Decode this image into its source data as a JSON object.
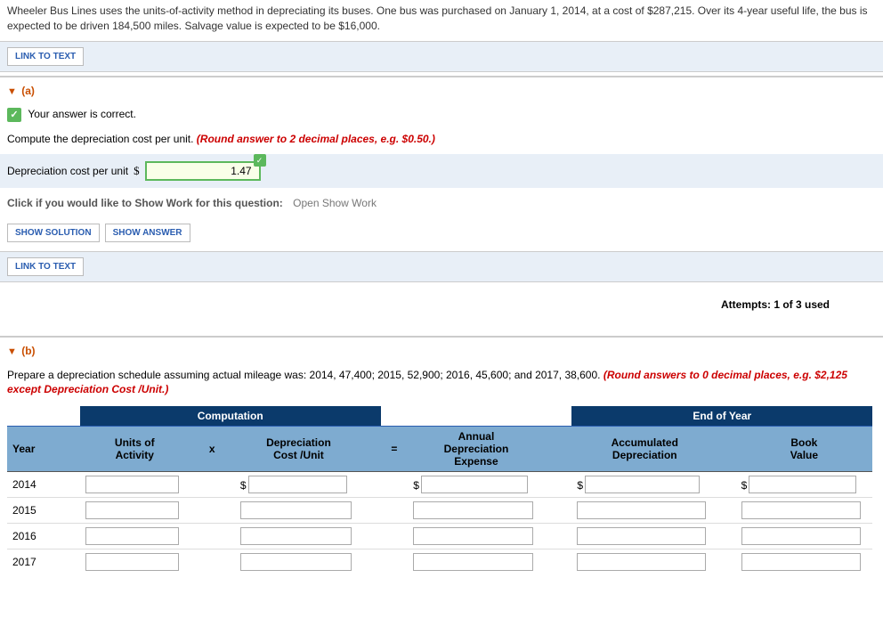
{
  "problem_text": "Wheeler Bus Lines uses the units-of-activity method in depreciating its buses. One bus was purchased on January 1, 2014, at a cost of $287,215. Over its 4-year useful life, the bus is expected to be driven 184,500 miles. Salvage value is expected to be $16,000.",
  "link_to_text": "LINK TO TEXT",
  "part_a": {
    "label": "(a)",
    "correct_msg": "Your answer is correct.",
    "instruction_plain": "Compute the depreciation cost per unit. ",
    "instruction_red": "(Round answer to 2 decimal places, e.g. $0.50.)",
    "input_label": "Depreciation cost per unit",
    "currency": "$",
    "value": "1.47",
    "show_work_label": "Click if you would like to Show Work for this question:",
    "show_work_link": "Open Show Work",
    "show_solution": "SHOW SOLUTION",
    "show_answer": "SHOW ANSWER",
    "attempts": "Attempts: 1 of 3 used"
  },
  "part_b": {
    "label": "(b)",
    "instruction_plain": "Prepare a depreciation schedule assuming actual mileage was: 2014, 47,400; 2015, 52,900; 2016, 45,600; and 2017, 38,600. ",
    "instruction_red": "(Round answers to 0 decimal places, e.g. $2,125 except Depreciation Cost /Unit.)",
    "table": {
      "group_computation": "Computation",
      "group_endofyear": "End of Year",
      "col_year": "Year",
      "col_units": "Units of\nActivity",
      "col_x": "x",
      "col_cost": "Depreciation\nCost /Unit",
      "col_eq": "=",
      "col_annual": "Annual\nDepreciation\nExpense",
      "col_accum": "Accumulated\nDepreciation",
      "col_book": "Book\nValue",
      "years": [
        "2014",
        "2015",
        "2016",
        "2017"
      ]
    }
  }
}
